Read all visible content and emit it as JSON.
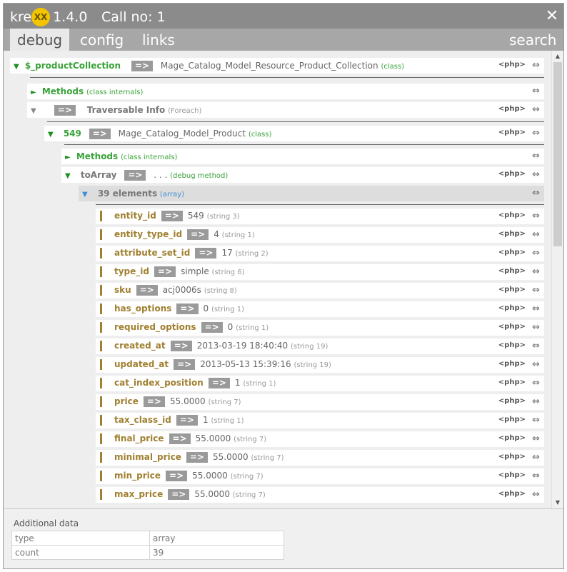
{
  "app": {
    "logo_prefix": "kre",
    "logo_badge": "XX",
    "version": "1.4.0",
    "call_label": "Call no: 1",
    "close_icon": "close-icon"
  },
  "tabs": [
    {
      "label": "debug"
    },
    {
      "label": "config"
    },
    {
      "label": "links"
    },
    {
      "label": "search"
    }
  ],
  "tree": {
    "root": {
      "name": "$_productCollection",
      "connector": "=>",
      "value": "Mage_Catalog_Model_Resource_Product_Collection",
      "note": "(class)",
      "php": "<php>"
    },
    "methods1": {
      "name": "Methods",
      "note": "(class internals)"
    },
    "traversable": {
      "connector": "=>",
      "name": "Traversable Info",
      "note": "(Foreach)",
      "php": "<php>"
    },
    "item549": {
      "name": "549",
      "connector": "=>",
      "value": "Mage_Catalog_Model_Product",
      "note": "(class)",
      "php": "<php>"
    },
    "methods2": {
      "name": "Methods",
      "note": "(class internals)"
    },
    "toarray": {
      "name": "toArray",
      "connector": "=>",
      "value": ". . .",
      "note": "(debug method)",
      "php": "<php>"
    },
    "elements": {
      "name": "39 elements",
      "note": "(array)"
    },
    "rows": [
      {
        "key": "entity_id",
        "value": "549",
        "note": "(string 3)",
        "php": "<php>"
      },
      {
        "key": "entity_type_id",
        "value": "4",
        "note": "(string 1)",
        "php": "<php>"
      },
      {
        "key": "attribute_set_id",
        "value": "17",
        "note": "(string 2)",
        "php": "<php>"
      },
      {
        "key": "type_id",
        "value": "simple",
        "note": "(string 6)",
        "php": "<php>"
      },
      {
        "key": "sku",
        "value": "acj0006s",
        "note": "(string 8)",
        "php": "<php>"
      },
      {
        "key": "has_options",
        "value": "0",
        "note": "(string 1)",
        "php": "<php>"
      },
      {
        "key": "required_options",
        "value": "0",
        "note": "(string 1)",
        "php": "<php>"
      },
      {
        "key": "created_at",
        "value": "2013-03-19 18:40:40",
        "note": "(string 19)",
        "php": "<php>"
      },
      {
        "key": "updated_at",
        "value": "2013-05-13 15:39:16",
        "note": "(string 19)",
        "php": "<php>"
      },
      {
        "key": "cat_index_position",
        "value": "1",
        "note": "(string 1)",
        "php": "<php>"
      },
      {
        "key": "price",
        "value": "55.0000",
        "note": "(string 7)",
        "php": "<php>"
      },
      {
        "key": "tax_class_id",
        "value": "1",
        "note": "(string 1)",
        "php": "<php>"
      },
      {
        "key": "final_price",
        "value": "55.0000",
        "note": "(string 7)",
        "php": "<php>"
      },
      {
        "key": "minimal_price",
        "value": "55.0000",
        "note": "(string 7)",
        "php": "<php>"
      },
      {
        "key": "min_price",
        "value": "55.0000",
        "note": "(string 7)",
        "php": "<php>"
      },
      {
        "key": "max_price",
        "value": "55.0000",
        "note": "(string 7)",
        "php": "<php>"
      }
    ]
  },
  "footer": {
    "title": "Additional data",
    "rows": [
      {
        "key": "type",
        "value": "array"
      },
      {
        "key": "count",
        "value": "39"
      }
    ]
  }
}
